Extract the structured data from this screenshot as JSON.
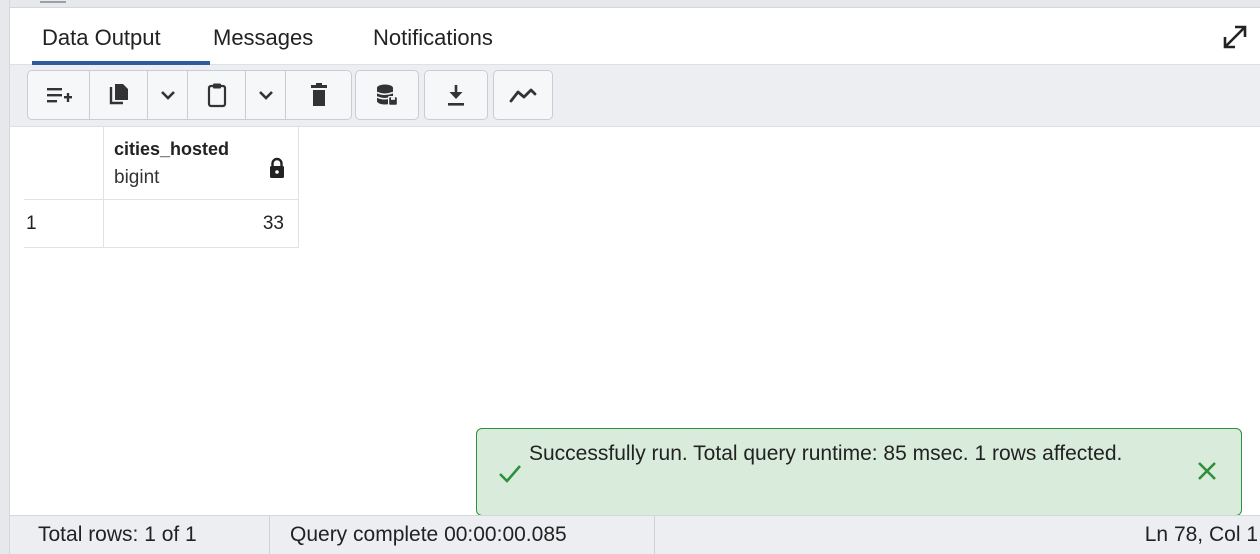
{
  "tabs": [
    {
      "label": "Data Output",
      "active": true
    },
    {
      "label": "Messages",
      "active": false
    },
    {
      "label": "Notifications",
      "active": false
    }
  ],
  "icons": {
    "expand": "expand-arrows-icon",
    "add_row": "add-row-icon",
    "copy": "copy-icon",
    "paste": "paste-icon",
    "delete": "trash-icon",
    "save_data": "database-save-icon",
    "download": "download-icon",
    "graph": "line-graph-icon",
    "lock": "lock-icon",
    "success": "check-icon",
    "close": "close-icon"
  },
  "grid": {
    "columns": [
      {
        "name": "cities_hosted",
        "type": "bigint",
        "readonly": true
      }
    ],
    "rows": [
      {
        "num": "1",
        "values": [
          "33"
        ]
      }
    ]
  },
  "toast": {
    "message": "Successfully run. Total query runtime: 85 msec. 1 rows affected.",
    "color": "#2f8f3a"
  },
  "status": {
    "rows": "Total rows: 1 of 1",
    "query": "Query complete 00:00:00.085",
    "position": "Ln 78, Col 1"
  },
  "colors": {
    "accent": "#2e5aa0",
    "toolbar_bg": "#eceef1",
    "success_bg": "#d9ecdb"
  }
}
